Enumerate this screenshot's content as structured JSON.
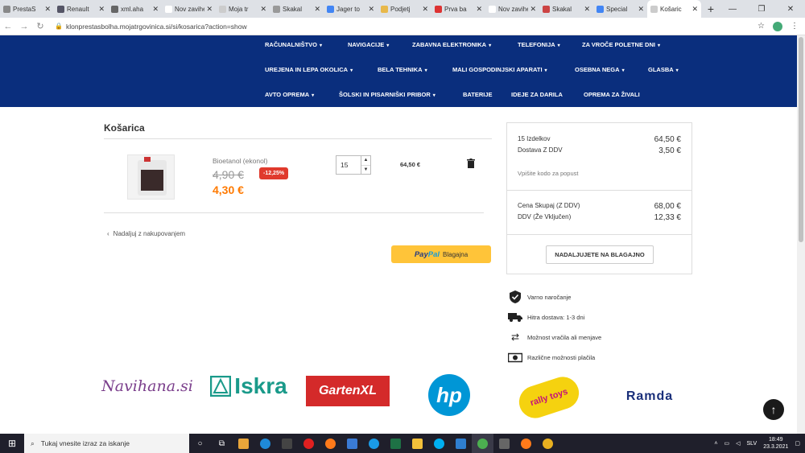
{
  "browser": {
    "tabs": [
      {
        "label": "PrestaS",
        "color": "#888"
      },
      {
        "label": "Renault",
        "color": "#556"
      },
      {
        "label": "xml.aha",
        "color": "#666"
      },
      {
        "label": "Nov zavihek",
        "color": "#fff"
      },
      {
        "label": "Moja tr",
        "color": "#ccc"
      },
      {
        "label": "Skakal",
        "color": "#999"
      },
      {
        "label": "Jager to",
        "color": "#4285f4"
      },
      {
        "label": "Podjetj",
        "color": "#e8b84a"
      },
      {
        "label": "Prva ba",
        "color": "#d33"
      },
      {
        "label": "Nov zavihek",
        "color": "#fff"
      },
      {
        "label": "Skakal",
        "color": "#c44"
      },
      {
        "label": "Special",
        "color": "#4285f4"
      },
      {
        "label": "Košaric",
        "color": "#ccc"
      }
    ],
    "new_tab": "+",
    "url": "klonprestasbolha.mojatrgovinica.si/si/kosarica?action=show"
  },
  "menu": {
    "row1": [
      "RAČUNALNIŠTVO",
      "NAVIGACIJE",
      "ZABAVNA ELEKTRONIKA",
      "TELEFONIJA",
      "ZA VROČE POLETNE DNI"
    ],
    "row2": [
      "UREJENA IN LEPA OKOLICA",
      "BELA TEHNIKA",
      "MALI GOSPODINJSKI APARATI",
      "OSEBNA NEGA",
      "GLASBA"
    ],
    "row3": [
      "AVTO OPREMA",
      "ŠOLSKI IN PISARNIŠKI PRIBOR",
      "BATERIJE",
      "IDEJE ZA DARILA",
      "OPREMA ZA ŽIVALI"
    ]
  },
  "cart": {
    "title": "Košarica",
    "item": {
      "name": "Bioetanol (ekonol)",
      "old_price": "4,90 €",
      "discount": "-12,25%",
      "new_price": "4,30 €",
      "quantity": "15",
      "line_total": "64,50 €"
    },
    "continue_label": "Nadaljuj z nakupovanjem",
    "paypal_label": "Blagajna",
    "paypal_logo_a": "Pay",
    "paypal_logo_b": "Pal"
  },
  "summary": {
    "items_label": "15 Izdelkov",
    "items_value": "64,50 €",
    "shipping_label": "Dostava Z DDV",
    "shipping_value": "3,50 €",
    "promo_label": "Vpišite kodo za popust",
    "total_label": "Cena Skupaj (Z DDV)",
    "total_value": "68,00 €",
    "vat_label": "DDV (Že Vključen)",
    "vat_value": "12,33 €",
    "checkout_label": "NADALJUJETE NA BLAGAJNO"
  },
  "reassurance": [
    {
      "text": "Varno naročanje",
      "icon": "shield-check-icon"
    },
    {
      "text": "Hitra dostava: 1-3 dni",
      "icon": "truck-icon"
    },
    {
      "text": "Možnost vračila ali menjave",
      "icon": "exchange-arrows-icon"
    },
    {
      "text": "Različne možnosti plačila",
      "icon": "cash-icon"
    }
  ],
  "brands": {
    "navihana": "Navihana.si",
    "iskra": "Iskra",
    "garten": "GartenXL",
    "hp": "hp",
    "rally": "rally toys",
    "ramda": "Ramda"
  },
  "taskbar": {
    "search_placeholder": "Tukaj vnesite izraz za iskanje",
    "lang": "SLV",
    "time": "18:49",
    "date": "23.3.2021"
  },
  "colors": {
    "menu_bg": "#0a2e7d",
    "accent_orange": "#ff7a00",
    "discount_red": "#e03a2d",
    "paypal_yellow": "#ffc439"
  }
}
